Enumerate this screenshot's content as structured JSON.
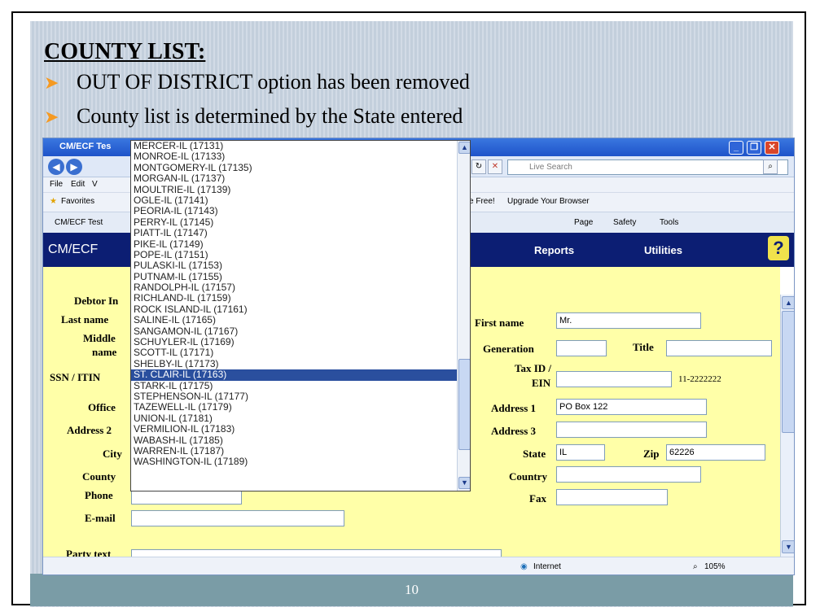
{
  "slide": {
    "title": "COUNTY LIST:",
    "bullets": [
      "OUT OF DISTRICT option has been removed",
      "County list is determined by the State entered"
    ],
    "page_number": "10"
  },
  "browser": {
    "window_title": "CM/ECF Tes",
    "search_placeholder": "Live Search",
    "menu": [
      "File",
      "Edit",
      "V"
    ],
    "favorites_label": "Favorites",
    "fav_links": [
      "e Free!",
      "Upgrade Your Browser"
    ],
    "tab_label": "CM/ECF Test",
    "cmd_items": [
      "Page",
      "Safety",
      "Tools"
    ],
    "status_zone": "Internet",
    "zoom": "105%"
  },
  "app": {
    "logo": "CM/ECF",
    "menu_reports": "Reports",
    "menu_utilities": "Utilities",
    "help": "?"
  },
  "form": {
    "debtor_info_label": "Debtor In",
    "last_name_label": "Last name",
    "middle_name_label_1": "Middle",
    "middle_name_label_2": "name",
    "ssn_label": "SSN / ITIN",
    "office_label": "Office",
    "address2_label": "Address 2",
    "city_label": "City",
    "county_label": "County",
    "phone_label": "Phone",
    "email_label": "E-mail",
    "party_text_label": "Party text",
    "first_name_label": "First name",
    "first_name_value": "Mr.",
    "generation_label": "Generation",
    "title_label": "Title",
    "taxid_label_1": "Tax ID /",
    "taxid_label_2": "EIN",
    "taxid_hint": "11-2222222",
    "address1_label": "Address 1",
    "address1_value": "PO Box 122",
    "address3_label": "Address 3",
    "state_label": "State",
    "state_value": "IL",
    "zip_label": "Zip",
    "zip_value": "62226",
    "country_label": "Country",
    "fax_label": "Fax"
  },
  "county_dropdown": {
    "selected": "ST. CLAIR-IL (17163)",
    "items": [
      "MERCER-IL (17131)",
      "MONROE-IL (17133)",
      "MONTGOMERY-IL (17135)",
      "MORGAN-IL (17137)",
      "MOULTRIE-IL (17139)",
      "OGLE-IL (17141)",
      "PEORIA-IL (17143)",
      "PERRY-IL (17145)",
      "PIATT-IL (17147)",
      "PIKE-IL (17149)",
      "POPE-IL (17151)",
      "PULASKI-IL (17153)",
      "PUTNAM-IL (17155)",
      "RANDOLPH-IL (17157)",
      "RICHLAND-IL (17159)",
      "ROCK ISLAND-IL (17161)",
      "SALINE-IL (17165)",
      "SANGAMON-IL (17167)",
      "SCHUYLER-IL (17169)",
      "SCOTT-IL (17171)",
      "SHELBY-IL (17173)",
      "ST. CLAIR-IL (17163)",
      "STARK-IL (17175)",
      "STEPHENSON-IL (17177)",
      "TAZEWELL-IL (17179)",
      "UNION-IL (17181)",
      "VERMILION-IL (17183)",
      "WABASH-IL (17185)",
      "WARREN-IL (17187)",
      "WASHINGTON-IL (17189)"
    ]
  }
}
